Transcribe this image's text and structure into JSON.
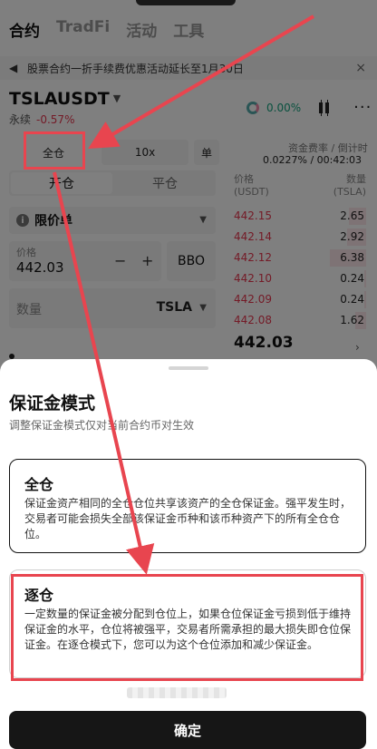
{
  "tabs": [
    "合约",
    "TradFi",
    "活动",
    "工具"
  ],
  "notice": {
    "text": "股票合约一折手续费优惠活动延长至1月30日",
    "close": "×"
  },
  "symbol": {
    "name": "TSLAUSDT",
    "type": "永续",
    "change": "-0.57%"
  },
  "stats": {
    "percent": "0.00%"
  },
  "controls": {
    "margin_mode": "全仓",
    "leverage": "10x",
    "unit_toggle": "单"
  },
  "funding": {
    "header": "资金费率 / 倒计时",
    "value": "0.0227% / 00:42:03"
  },
  "side": {
    "open": "开仓",
    "close": "平仓"
  },
  "orderbook": {
    "price_header": "价格\n(USDT)",
    "qty_header": "数量\n(TSLA)",
    "asks": [
      {
        "price": "442.15",
        "qty": "2.65",
        "depth": 0.48
      },
      {
        "price": "442.14",
        "qty": "2.92",
        "depth": 0.53
      },
      {
        "price": "442.12",
        "qty": "6.38",
        "depth": 1.0
      },
      {
        "price": "442.10",
        "qty": "0.24",
        "depth": 0.05
      },
      {
        "price": "442.09",
        "qty": "0.24",
        "depth": 0.05
      },
      {
        "price": "442.08",
        "qty": "1.62",
        "depth": 0.3
      }
    ],
    "last_price": "442.03"
  },
  "order": {
    "type": "限价单",
    "price_label": "价格",
    "price_value": "442.03",
    "bbo": "BBO",
    "qty_label": "数量",
    "qty_unit": "TSLA"
  },
  "sheet": {
    "title": "保证金模式",
    "subtitle": "调整保证金模式仅对当前合约币对生效",
    "cross": {
      "title": "全仓",
      "desc": "保证金资产相同的全仓仓位共享该资产的全仓保证金。强平发生时，交易者可能会损失全部该保证金币种和该币种资产下的所有全仓仓位。"
    },
    "isolated": {
      "title": "逐仓",
      "desc": "一定数量的保证金被分配到仓位上，如果仓位保证金亏损到低于维持保证金的水平，仓位将被强平，交易者所需承担的最大损失即仓位保证金。在逐仓模式下，您可以为这个仓位添加和减少保证金。"
    },
    "confirm": "确定"
  },
  "colors": {
    "annotation": "#e8454f",
    "down": "#e8364f",
    "up": "#14a37f"
  }
}
